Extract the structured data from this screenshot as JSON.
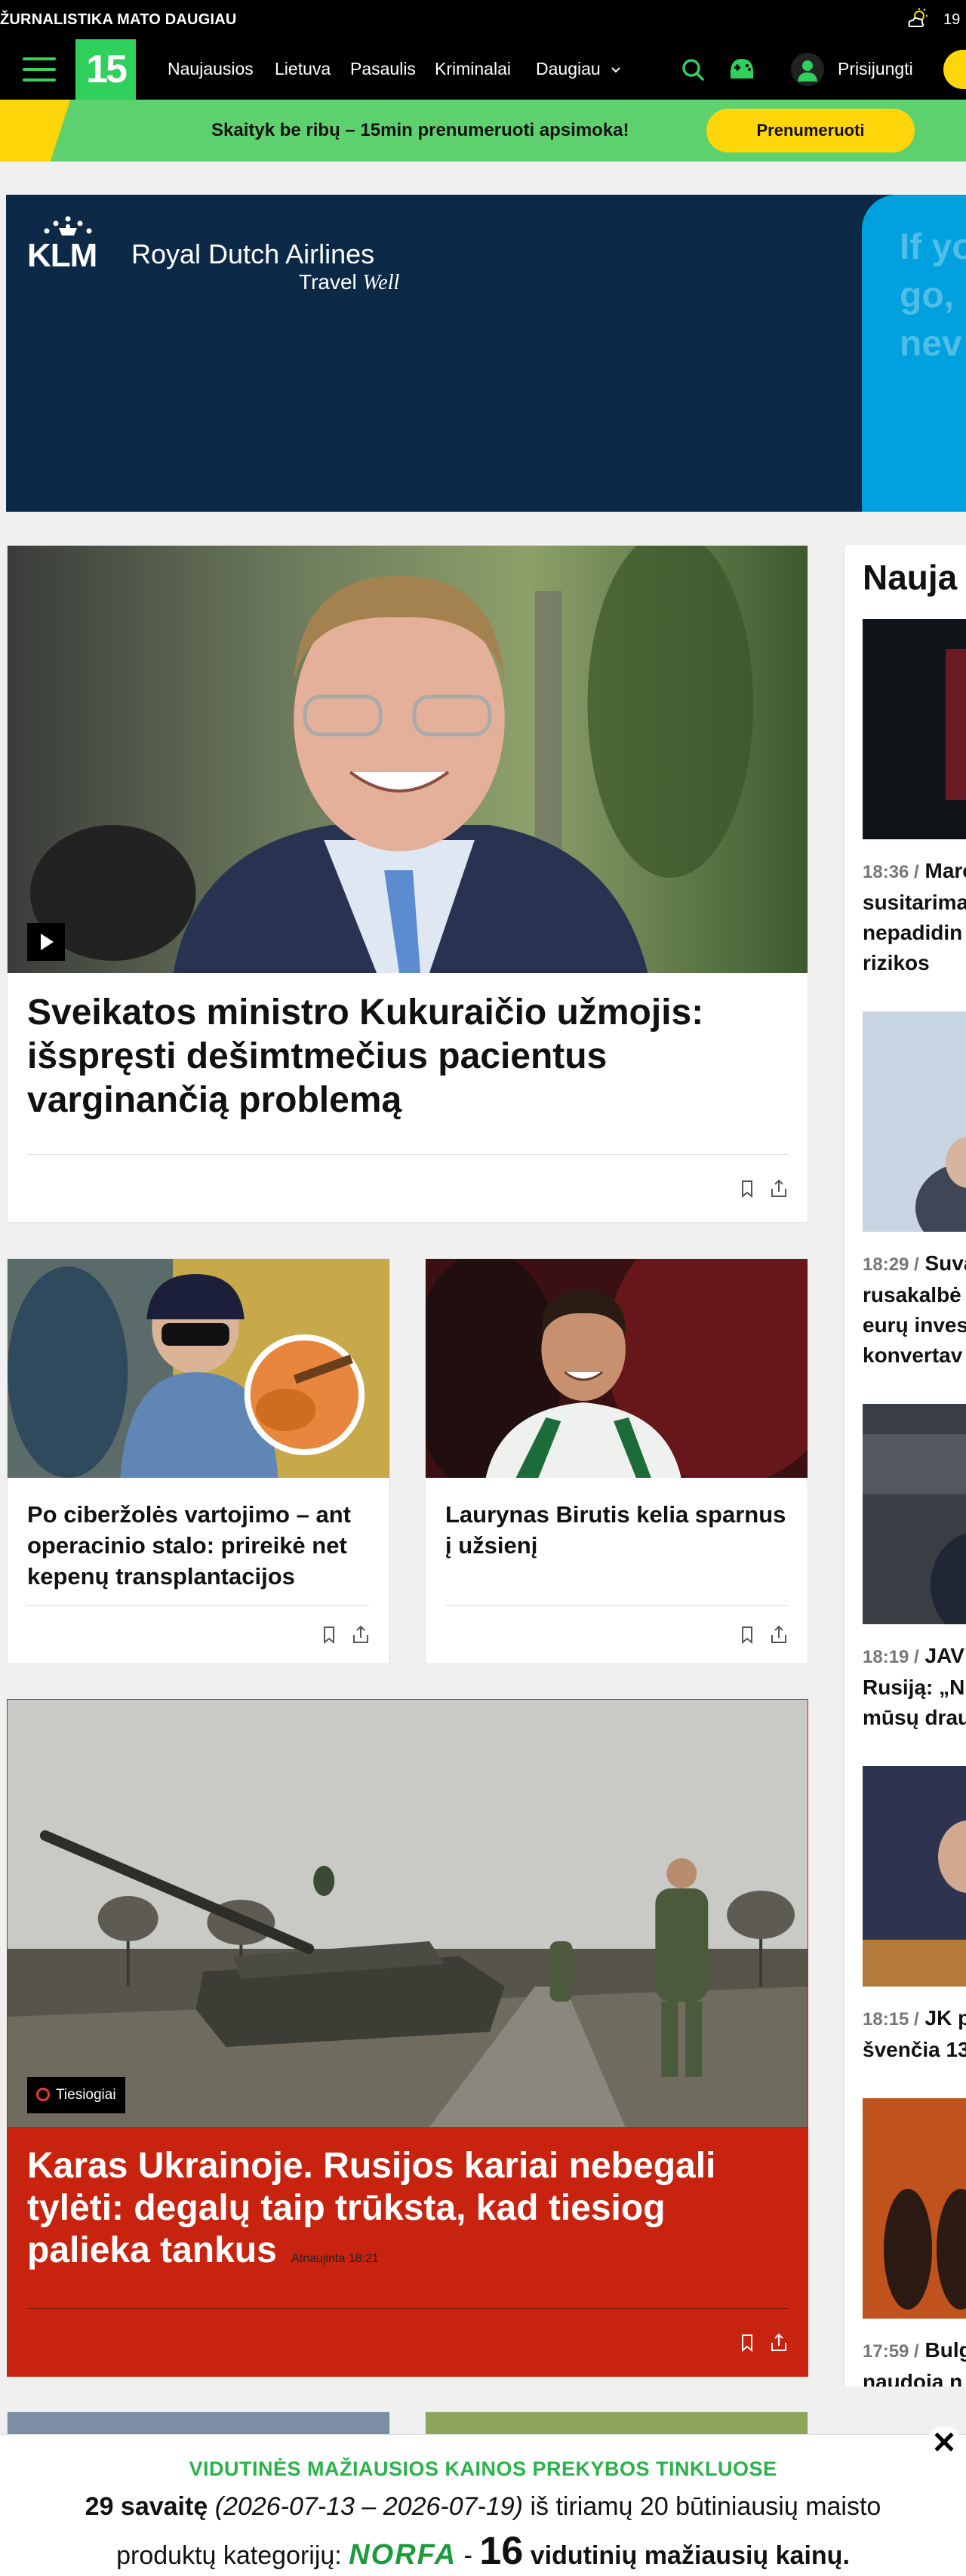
{
  "topbar": {
    "slogan": "ŽURNALISTIKA MATO DAUGIAU",
    "temperature": "19",
    "weather_icon": "sun-cloud-icon"
  },
  "nav": {
    "logo": "15",
    "items": [
      "Naujausios",
      "Lietuva",
      "Pasaulis",
      "Kriminalai",
      "Daugiau"
    ],
    "login": "Prisijungti",
    "colors": {
      "brand_green": "#2fd05b",
      "accent_yellow": "#ffd60a"
    }
  },
  "promo": {
    "text": "Skaityk be ribų – 15min prenumeruoti apsimoka!",
    "button": "Prenumeruoti"
  },
  "ad": {
    "brand": "KLM",
    "name": "Royal Dutch Airlines",
    "tagline_a": "Travel",
    "tagline_b": "Well",
    "side_text_1": "If yo",
    "side_text_2": "go,",
    "side_text_3": "nev"
  },
  "articles": {
    "main": {
      "title": "Sveikatos ministro Kukuraičio užmojis: išspręsti dešimtmečius pacientus varginančią problemą"
    },
    "left": {
      "title": "Po ciberžolės vartojimo – ant operacinio stalo: prireikė net kepenų transplantacijos"
    },
    "right": {
      "title": "Laurynas Birutis kelia sparnus į užsienį"
    },
    "live": {
      "badge": "Tiesiogiai",
      "title": "Karas Ukrainoje. Rusijos kariai nebegali tylėti: degalų taip trūksta, kad tiesiog palieka tankus",
      "updated": "Atnaujinta 18:21"
    }
  },
  "rail": {
    "heading": "Nauja",
    "items": [
      {
        "time": "18:36 /",
        "lines": [
          "Marc",
          "susitarima",
          "nepadidin",
          "rizikos"
        ]
      },
      {
        "time": "18:29 /",
        "lines": [
          "Suva",
          "rusakalbė",
          "eurų inves",
          "konvertav"
        ]
      },
      {
        "time": "18:19 /",
        "lines": [
          "JAV",
          "Rusiją: „N",
          "mūsų drau"
        ]
      },
      {
        "time": "18:15 /",
        "lines": [
          "JK p",
          "švenčia 13"
        ]
      },
      {
        "time": "17:59 /",
        "lines": [
          "Bulg",
          "naudoja n"
        ]
      }
    ]
  },
  "bottom_banner": {
    "line1": "VIDUTINĖS MAŽIAUSIOS KAINOS PREKYBOS TINKLUOSE",
    "week": "29 savaitę",
    "range": "(2026-07-13 – 2026-07-19)",
    "rest1": "iš tiriamų 20 būtiniausių maisto",
    "rest2": "produktų kategorijų:",
    "brand": "NORFA",
    "dash": "-",
    "count": "16",
    "rest3": "vidutinių mažiausių kainų."
  }
}
